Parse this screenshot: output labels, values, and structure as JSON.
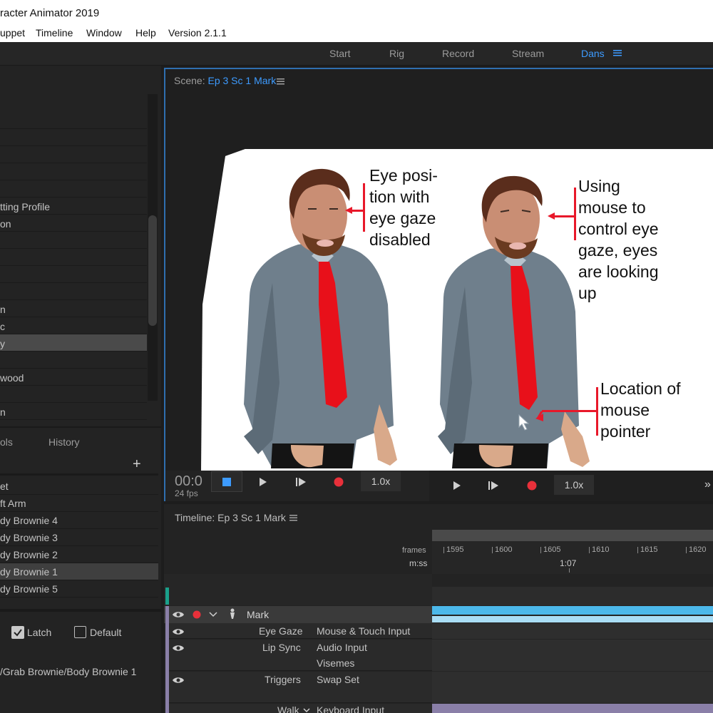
{
  "app": {
    "title": "racter Animator 2019",
    "menu": [
      "uppet",
      "Timeline",
      "Window",
      "Help",
      "Version 2.1.1"
    ]
  },
  "workspace": {
    "tabs": [
      "Start",
      "Rig",
      "Record",
      "Stream"
    ],
    "active_tab": "Dans"
  },
  "project_list": {
    "items": [
      "",
      "",
      "",
      "",
      "",
      "tting Profile",
      "on",
      "",
      "",
      "",
      "",
      "n",
      "c",
      "y",
      "",
      "wood",
      "",
      "n"
    ],
    "selected_index": 13
  },
  "panel_tabs": {
    "left_tab": "ols",
    "right_tab": "History",
    "add": "+"
  },
  "properties": {
    "items": [
      "et",
      "ft Arm",
      "dy Brownie 4",
      "dy Brownie 3",
      "dy Brownie 2",
      "dy Brownie 1",
      "dy Brownie 5"
    ],
    "selected_index": 5
  },
  "latch": {
    "latch_label": "Latch",
    "latch_checked": true,
    "default_label": "Default",
    "default_checked": false
  },
  "path_text": "/Grab Brownie/Body Brownie 1",
  "scene": {
    "label": "Scene:",
    "name": "Ep 3 Sc 1 Mark",
    "time_text": "00:0",
    "fps_text": "24 fps",
    "speed_left": "1.0x",
    "speed_right": "1.0x",
    "expand_glyph": "»"
  },
  "annotations": {
    "left": [
      "Eye posi-",
      "tion with",
      "eye gaze",
      "disabled"
    ],
    "right": [
      "Using",
      "mouse to",
      "control eye",
      "gaze, eyes",
      "are looking",
      "up"
    ],
    "pointer": [
      "Location of",
      "mouse",
      "pointer"
    ]
  },
  "timeline": {
    "title": "Timeline: Ep 3 Sc 1 Mark",
    "frames_label": "frames",
    "mss_label": "m:ss",
    "frames": [
      "1595",
      "1600",
      "1605",
      "1610",
      "1615",
      "1620"
    ],
    "time_marker": "1:07",
    "puppet_name": "Mark",
    "behaviors": [
      {
        "name": "Eye Gaze",
        "inputs": [
          "Mouse & Touch Input"
        ]
      },
      {
        "name": "Lip Sync",
        "inputs": [
          "Audio Input",
          "Visemes"
        ]
      },
      {
        "name": "Triggers",
        "inputs": [
          "Swap Set"
        ]
      },
      {
        "name": "Walk",
        "inputs": [
          "Keyboard Input"
        ]
      }
    ]
  },
  "colors": {
    "accent_blue": "#3d9bff",
    "record_red": "#e8303a",
    "annotation_red": "#e8182a",
    "track_blue": "#4cb8ea",
    "track_purple": "#8a7fa8"
  }
}
